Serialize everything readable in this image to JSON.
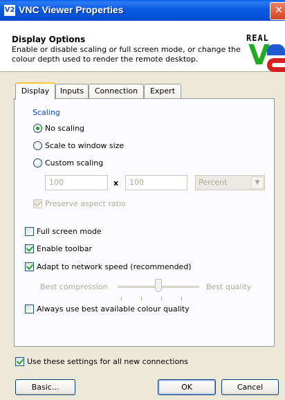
{
  "window": {
    "title": "VNC Viewer Properties",
    "icon_text": "V2",
    "close_glyph": "✕"
  },
  "header": {
    "title": "Display Options",
    "description": "Enable or disable scaling or full screen mode, or change the colour depth used to render the remote desktop.",
    "logo_word": "REAL",
    "logo_letter": "V"
  },
  "tabs": [
    {
      "label": "Display"
    },
    {
      "label": "Inputs"
    },
    {
      "label": "Connection"
    },
    {
      "label": "Expert"
    }
  ],
  "active_tab": "Display",
  "scaling": {
    "legend": "Scaling",
    "options": [
      {
        "label": "No scaling",
        "checked": true
      },
      {
        "label": "Scale to window size",
        "checked": false
      },
      {
        "label": "Custom scaling",
        "checked": false
      }
    ],
    "width": "100",
    "separator": "x",
    "height": "100",
    "unit": "Percent",
    "preserve_aspect": {
      "label": "Preserve aspect ratio",
      "checked": true,
      "enabled": false
    }
  },
  "options": {
    "full_screen": {
      "label": "Full screen mode",
      "checked": false
    },
    "enable_toolbar": {
      "label": "Enable toolbar",
      "checked": true
    },
    "adapt_network": {
      "label": "Adapt to network speed (recommended)",
      "checked": true
    },
    "best_colour": {
      "label": "Always use best available colour quality",
      "checked": false
    }
  },
  "quality_slider": {
    "min_label": "Best compression",
    "max_label": "Best quality",
    "value_fraction": 0.5,
    "enabled": false
  },
  "use_for_all": {
    "label": "Use these settings for all new connections",
    "checked": true
  },
  "buttons": {
    "basic": "Basic...",
    "ok": "OK",
    "cancel": "Cancel"
  }
}
